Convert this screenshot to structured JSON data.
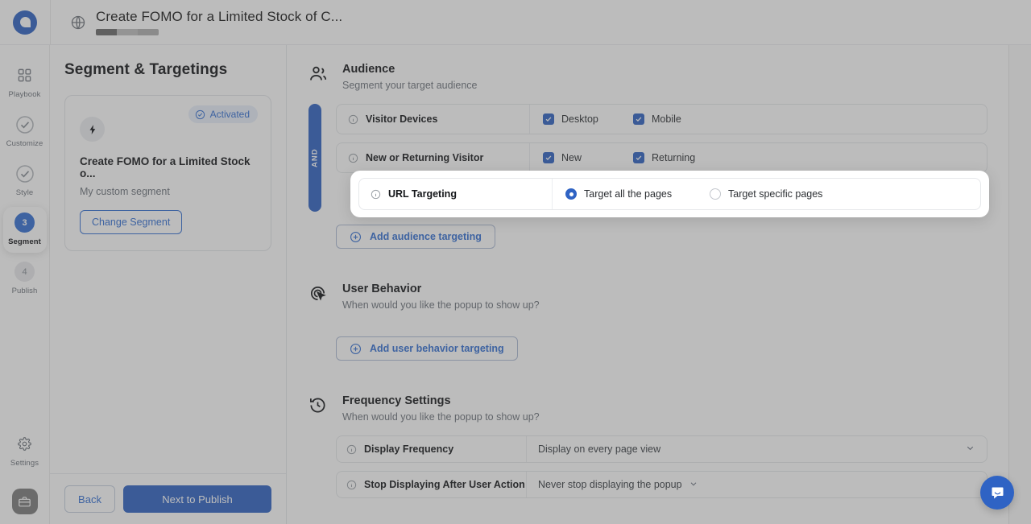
{
  "topbar": {
    "title": "Create FOMO for a Limited Stock of C...",
    "globe_icon": "globe-icon",
    "logo_icon": "app-logo",
    "progress": {
      "completed": 1,
      "total": 3
    }
  },
  "rail": {
    "items": [
      {
        "label": "Playbook",
        "icon": "grid-icon",
        "state": "icon",
        "number": ""
      },
      {
        "label": "Customize",
        "icon": "check-circle-icon",
        "state": "check",
        "number": ""
      },
      {
        "label": "Style",
        "icon": "check-circle-icon",
        "state": "check",
        "number": ""
      },
      {
        "label": "Segment",
        "icon": "step-number",
        "state": "active",
        "number": "3"
      },
      {
        "label": "Publish",
        "icon": "step-number",
        "state": "pending",
        "number": "4"
      }
    ],
    "settings_label": "Settings",
    "settings_icon": "gear-icon",
    "avatar_icon": "briefcase-icon"
  },
  "left_panel": {
    "heading": "Segment & Targetings",
    "badge": {
      "label": "Activated",
      "icon": "check-circle-icon"
    },
    "card_icon": "bolt-icon",
    "card_title": "Create FOMO for a Limited Stock o...",
    "card_subtitle": "My custom segment",
    "change_segment_label": "Change Segment",
    "back_label": "Back",
    "next_label": "Next to Publish"
  },
  "main": {
    "audience": {
      "icon": "audience-people-icon",
      "title": "Audience",
      "subtitle": "Segment your target audience",
      "and_label": "AND",
      "rules": [
        {
          "name": "Visitor Devices",
          "type": "checkbox",
          "options": [
            {
              "label": "Desktop",
              "checked": true
            },
            {
              "label": "Mobile",
              "checked": true
            }
          ]
        },
        {
          "name": "New or Returning Visitor",
          "type": "checkbox",
          "options": [
            {
              "label": "New",
              "checked": true
            },
            {
              "label": "Returning",
              "checked": true
            }
          ]
        }
      ],
      "highlighted_rule": {
        "name": "URL Targeting",
        "type": "radio",
        "options": [
          {
            "label": "Target all the pages",
            "selected": true
          },
          {
            "label": "Target specific pages",
            "selected": false
          }
        ]
      },
      "add_button": {
        "label": "Add audience targeting",
        "icon": "plus-circle-icon"
      }
    },
    "user_behavior": {
      "icon": "cursor-target-icon",
      "title": "User Behavior",
      "subtitle": "When would you like the popup to show up?",
      "add_button": {
        "label": "Add user behavior targeting",
        "icon": "plus-circle-icon"
      }
    },
    "frequency": {
      "icon": "clock-history-icon",
      "title": "Frequency Settings",
      "subtitle": "When would you like the popup to show up?",
      "rows": [
        {
          "name": "Display Frequency",
          "value": "Display on every page view",
          "chevron": "end"
        },
        {
          "name": "Stop Displaying After User Action",
          "value": "Never stop displaying the popup",
          "chevron": "inline"
        }
      ]
    }
  },
  "chat": {
    "icon": "chat-bubble-icon"
  },
  "colors": {
    "accent": "#2f63c4",
    "link": "#3470d4",
    "text": "#15171a",
    "muted": "#6e747c"
  }
}
